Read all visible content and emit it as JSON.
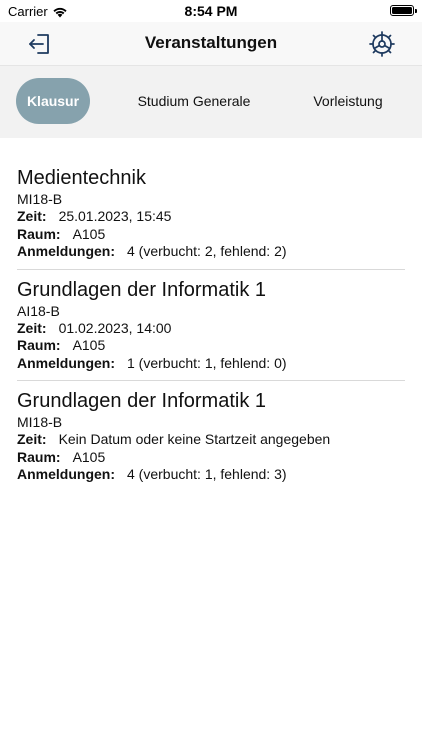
{
  "status": {
    "carrier": "Carrier",
    "time": "8:54 PM"
  },
  "nav": {
    "title": "Veranstaltungen",
    "left_icon": "logout-icon",
    "right_icon": "settings-icon"
  },
  "tabs": [
    {
      "label": "Klausur",
      "active": true
    },
    {
      "label": "Studium Generale",
      "active": false
    },
    {
      "label": "Vorleistung",
      "active": false
    }
  ],
  "labels": {
    "zeit": "Zeit:",
    "raum": "Raum:",
    "anmeldungen": "Anmeldungen:"
  },
  "events": [
    {
      "title": "Medientechnik",
      "group": "MI18-B",
      "zeit": "25.01.2023, 15:45",
      "raum": "A105",
      "anmeldungen": "4 (verbucht: 2, fehlend: 2)"
    },
    {
      "title": "Grundlagen der Informatik 1",
      "group": "AI18-B",
      "zeit": "01.02.2023, 14:00",
      "raum": "A105",
      "anmeldungen": "1 (verbucht: 1, fehlend: 0)"
    },
    {
      "title": "Grundlagen der Informatik 1",
      "group": "MI18-B",
      "zeit": "Kein Datum oder keine Startzeit angegeben",
      "raum": "A105",
      "anmeldungen": "4 (verbucht: 1, fehlend: 3)"
    }
  ]
}
